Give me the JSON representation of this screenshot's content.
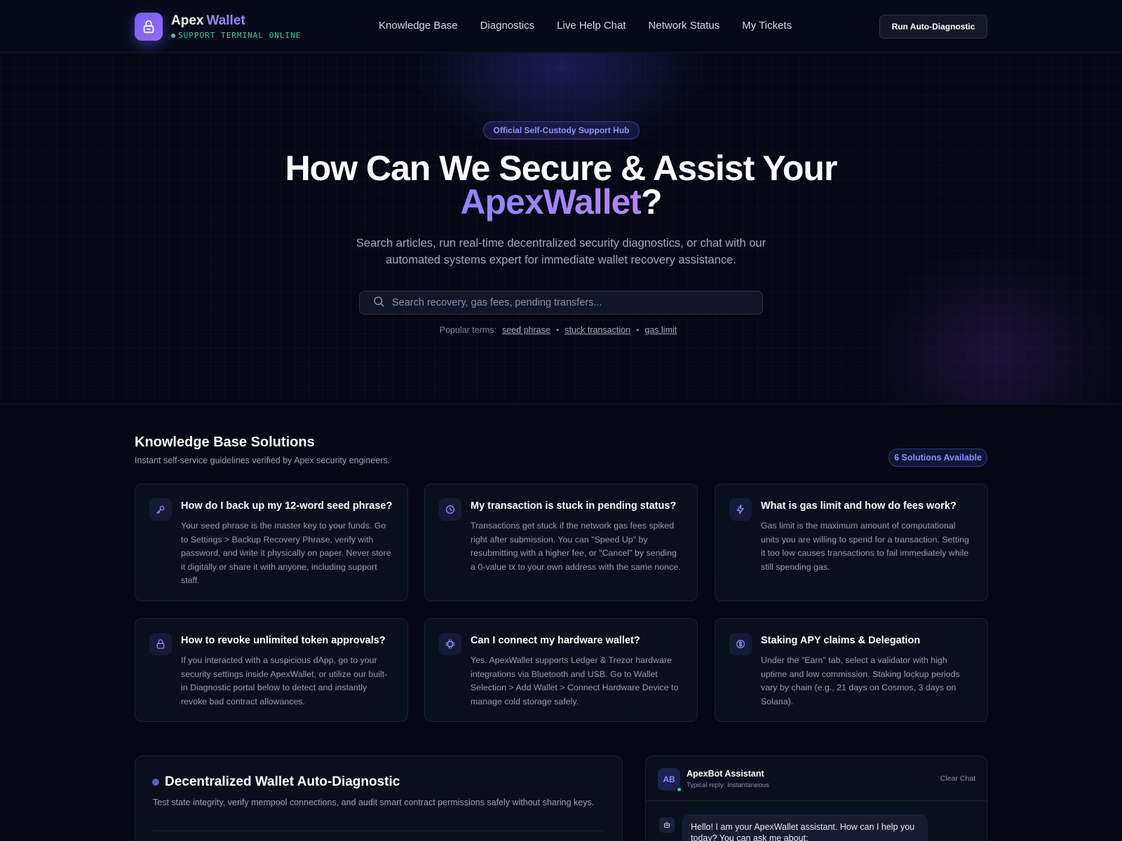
{
  "header": {
    "brand_name": "Apex",
    "brand_accent": "Wallet",
    "status": "SUPPORT TERMINAL ONLINE",
    "nav": [
      "Knowledge Base",
      "Diagnostics",
      "Live Help Chat",
      "Network Status",
      "My Tickets"
    ],
    "cta": "Run Auto-Diagnostic"
  },
  "hero": {
    "badge": "Official Self-Custody Support Hub",
    "title_line1": "How Can We Secure & Assist Your",
    "title_brand": "ApexWallet",
    "title_end": "?",
    "subtitle": "Search articles, run real-time decentralized security diagnostics, or chat with our automated systems expert for immediate wallet recovery assistance.",
    "search_placeholder": "Search recovery, gas fees, pending transfers...",
    "popular_label": "Popular terms:",
    "popular_terms": [
      "seed phrase",
      "stuck transaction",
      "gas limit"
    ],
    "separator": "•"
  },
  "knowledge_base": {
    "title": "Knowledge Base Solutions",
    "subtitle": "Instant self-service guidelines verified by Apex security engineers.",
    "count_badge": "6 Solutions Available",
    "cards": [
      {
        "icon": "key-icon",
        "title": "How do I back up my 12-word seed phrase?",
        "body": "Your seed phrase is the master key to your funds. Go to Settings > Backup Recovery Phrase, verify with password, and write it physically on paper. Never store it digitally or share it with anyone, including support staff."
      },
      {
        "icon": "clock-icon",
        "title": "My transaction is stuck in pending status?",
        "body": "Transactions get stuck if the network gas fees spiked right after submission. You can \"Speed Up\" by resubmitting with a higher fee, or \"Cancel\" by sending a 0-value tx to your own address with the same nonce."
      },
      {
        "icon": "lightning-icon",
        "title": "What is gas limit and how do fees work?",
        "body": "Gas limit is the maximum amount of computational units you are willing to spend for a transaction. Setting it too low causes transactions to fail immediately while still spending gas."
      },
      {
        "icon": "lock-icon",
        "title": "How to revoke unlimited token approvals?",
        "body": "If you interacted with a suspicious dApp, go to your security settings inside ApexWallet, or utilize our built-in Diagnostic portal below to detect and instantly revoke bad contract allowances."
      },
      {
        "icon": "chip-icon",
        "title": "Can I connect my hardware wallet?",
        "body": "Yes. ApexWallet supports Ledger & Trezor hardware integrations via Bluetooth and USB. Go to Wallet Selection > Add Wallet > Connect Hardware Device to manage cold storage safely."
      },
      {
        "icon": "dollar-icon",
        "title": "Staking APY claims & Delegation",
        "body": "Under the \"Earn\" tab, select a validator with high uptime and low commission. Staking lockup periods vary by chain (e.g., 21 days on Cosmos, 3 days on Solana)."
      }
    ]
  },
  "diagnostic": {
    "title": "Decentralized Wallet Auto-Diagnostic",
    "subtitle": "Test state integrity, verify mempool connections, and audit smart contract permissions safely without sharing keys."
  },
  "chat": {
    "avatar": "AB",
    "name": "ApexBot Assistant",
    "reply_time": "Typical reply: Instantaneous",
    "clear": "Clear Chat",
    "greeting": "Hello! I am your ApexWallet assistant. How can I help you today? You can ask me about:"
  },
  "colors": {
    "background": "#050814",
    "accent": "#8f8cff",
    "online": "#34d399"
  }
}
